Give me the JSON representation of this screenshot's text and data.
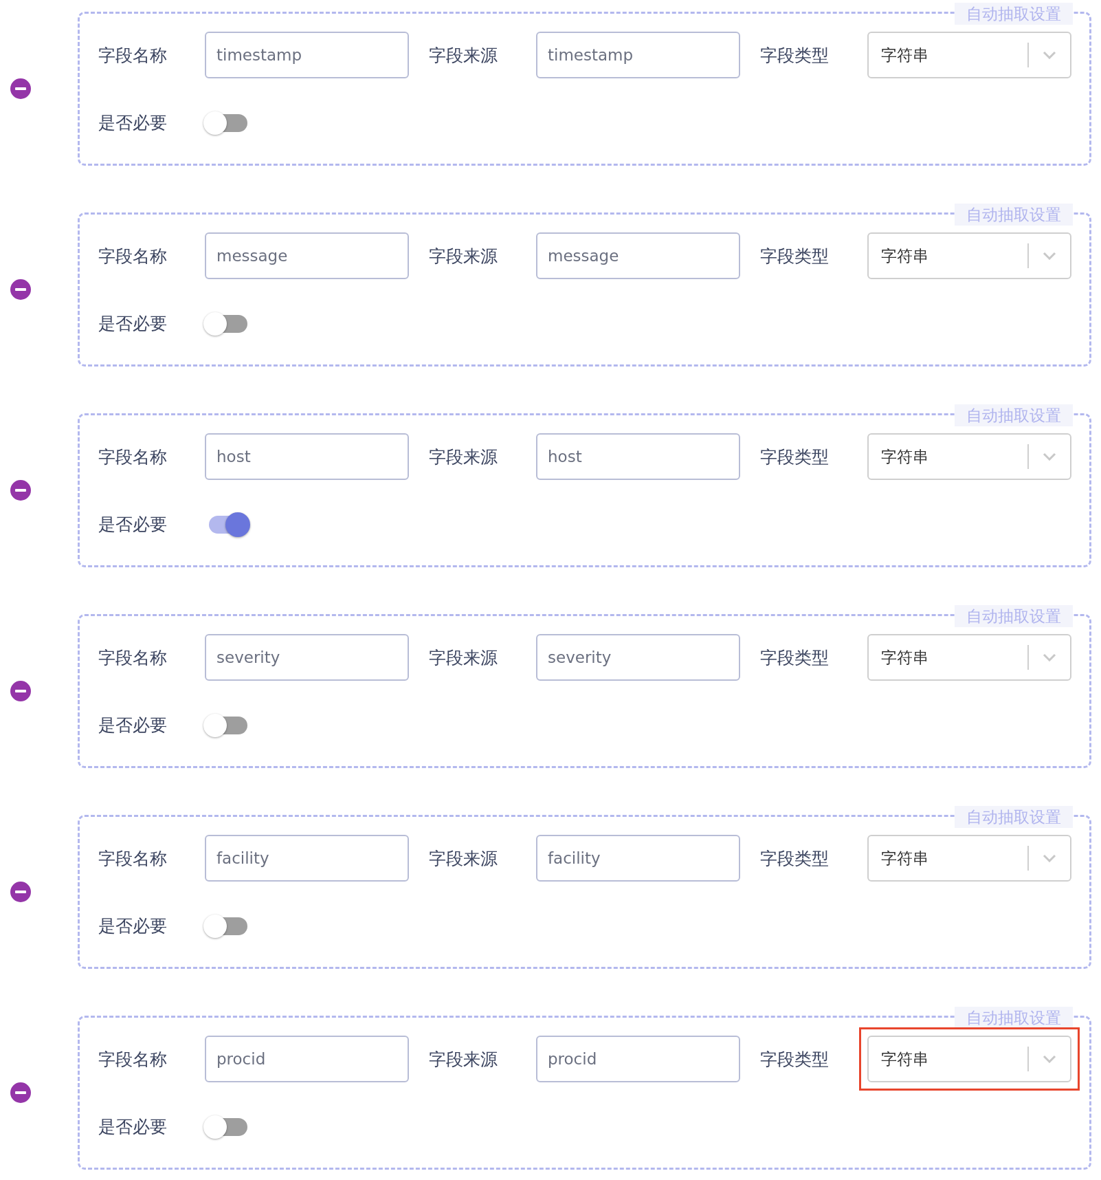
{
  "fields": [
    {
      "legend": "自动抽取设置",
      "name_label": "字段名称",
      "name": "timestamp",
      "source_label": "字段来源",
      "source": "timestamp",
      "type_label": "字段类型",
      "type": "字符串",
      "required_label": "是否必要",
      "required": false,
      "highlighted": false
    },
    {
      "legend": "自动抽取设置",
      "name_label": "字段名称",
      "name": "message",
      "source_label": "字段来源",
      "source": "message",
      "type_label": "字段类型",
      "type": "字符串",
      "required_label": "是否必要",
      "required": false,
      "highlighted": false
    },
    {
      "legend": "自动抽取设置",
      "name_label": "字段名称",
      "name": "host",
      "source_label": "字段来源",
      "source": "host",
      "type_label": "字段类型",
      "type": "字符串",
      "required_label": "是否必要",
      "required": true,
      "highlighted": false
    },
    {
      "legend": "自动抽取设置",
      "name_label": "字段名称",
      "name": "severity",
      "source_label": "字段来源",
      "source": "severity",
      "type_label": "字段类型",
      "type": "字符串",
      "required_label": "是否必要",
      "required": false,
      "highlighted": false
    },
    {
      "legend": "自动抽取设置",
      "name_label": "字段名称",
      "name": "facility",
      "source_label": "字段来源",
      "source": "facility",
      "type_label": "字段类型",
      "type": "字符串",
      "required_label": "是否必要",
      "required": false,
      "highlighted": false
    },
    {
      "legend": "自动抽取设置",
      "name_label": "字段名称",
      "name": "procid",
      "source_label": "字段来源",
      "source": "procid",
      "type_label": "字段类型",
      "type": "字符串",
      "required_label": "是否必要",
      "required": false,
      "highlighted": true
    }
  ]
}
